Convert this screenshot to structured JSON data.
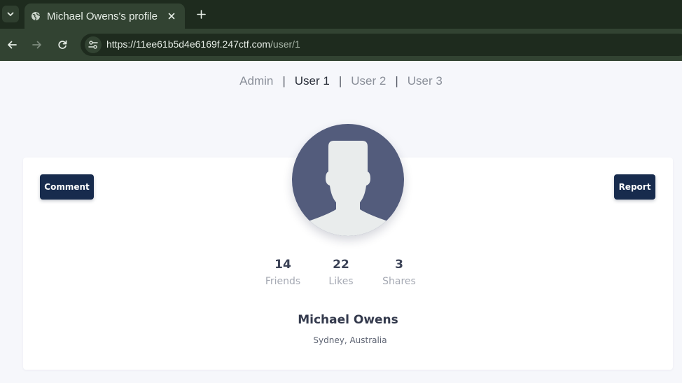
{
  "browser": {
    "tab": {
      "title": "Michael Owens's profile"
    },
    "url": {
      "host": "https://11ee61b5d4e6169f.247ctf.com",
      "path": "/user/1"
    }
  },
  "nav": {
    "items": [
      {
        "label": "Admin"
      },
      {
        "label": "User 1",
        "active": true
      },
      {
        "label": "User 2"
      },
      {
        "label": "User 3"
      }
    ],
    "separator": "|"
  },
  "profile": {
    "comment_label": "Comment",
    "report_label": "Report",
    "stats": [
      {
        "value": "14",
        "label": "Friends"
      },
      {
        "value": "22",
        "label": "Likes"
      },
      {
        "value": "3",
        "label": "Shares"
      }
    ],
    "name": "Michael Owens",
    "location": "Sydney, Australia"
  },
  "colors": {
    "accent": "#172b4d",
    "avatar_bg": "#535c7c",
    "avatar_figure": "#e9ecec",
    "chrome": "#324332"
  },
  "icons": {
    "tab_menu": "chevron-down-icon",
    "favicon": "globe-icon",
    "close": "close-icon",
    "new_tab": "plus-icon",
    "back": "arrow-left-icon",
    "forward": "arrow-right-icon",
    "reload": "reload-icon",
    "site_info": "tune-icon",
    "avatar": "user-silhouette-icon"
  }
}
